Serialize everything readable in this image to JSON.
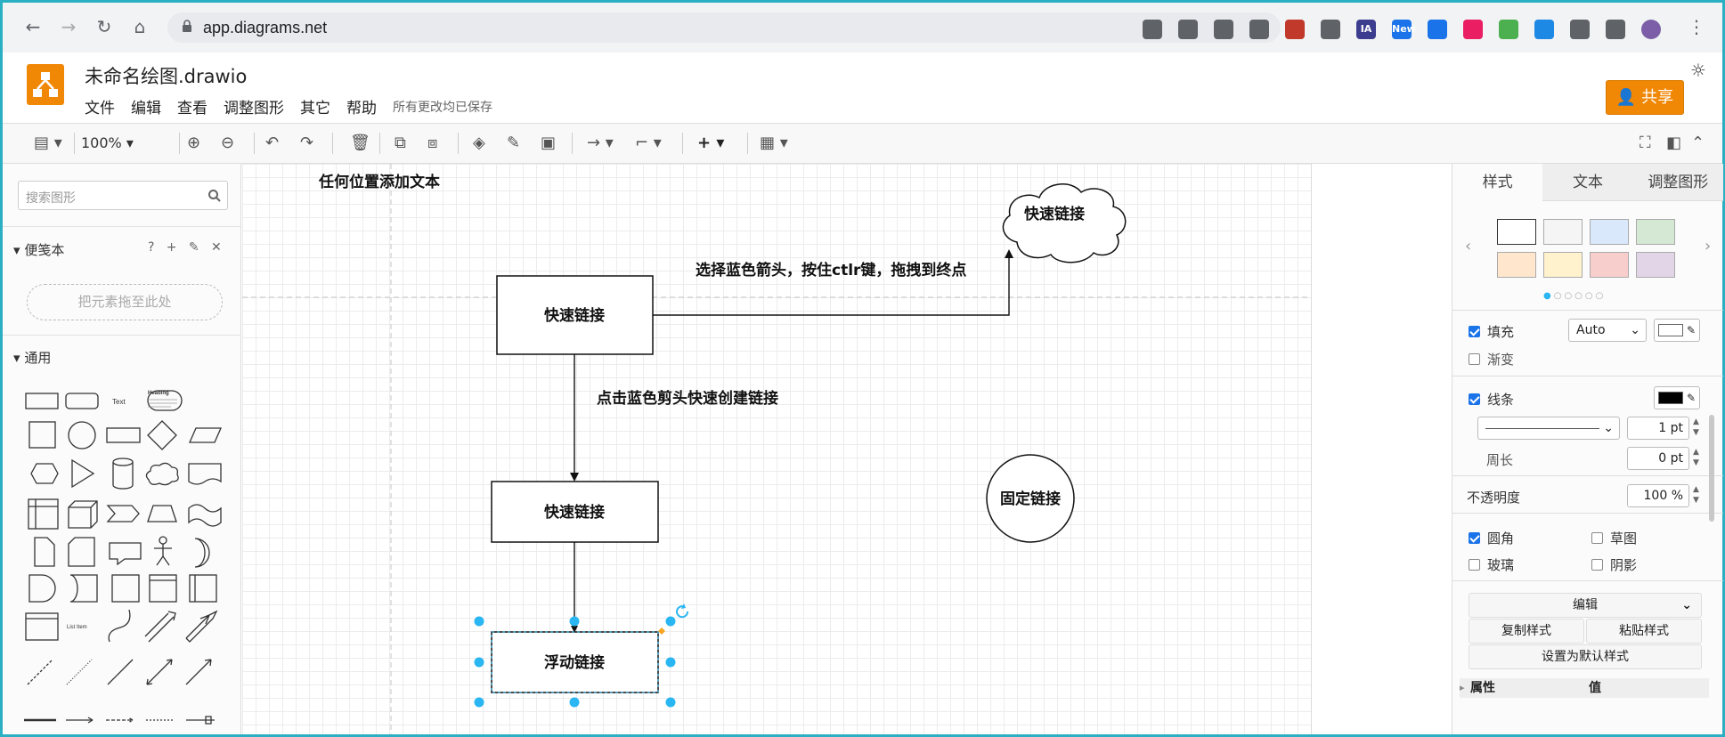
{
  "browser": {
    "url": "app.diagrams.net",
    "extensions": [
      {
        "name": "download-icon",
        "color": "#5f6368",
        "label": ""
      },
      {
        "name": "doc-icon",
        "color": "#5f6368",
        "label": ""
      },
      {
        "name": "share-page-icon",
        "color": "#5f6368",
        "label": ""
      },
      {
        "name": "star-icon",
        "color": "#5f6368",
        "label": ""
      },
      {
        "name": "html-ext-icon",
        "color": "#c0392b",
        "label": ""
      },
      {
        "name": "eyedropper-icon",
        "color": "#5f6368",
        "label": ""
      },
      {
        "name": "ia-ext-icon",
        "color": "#3d3d8f",
        "label": "IA"
      },
      {
        "name": "new-ext-icon",
        "color": "#1a73e8",
        "label": "New"
      },
      {
        "name": "circle-ext-icon",
        "color": "#1a73e8",
        "label": ""
      },
      {
        "name": "color-ext-icon",
        "color": "#e91e63",
        "label": ""
      },
      {
        "name": "grid-ext-icon",
        "color": "#4caf50",
        "label": ""
      },
      {
        "name": "drop-ext-icon",
        "color": "#1e88e5",
        "label": ""
      },
      {
        "name": "puzzle-icon",
        "color": "#5f6368",
        "label": ""
      },
      {
        "name": "sidebar-icon",
        "color": "#5f6368",
        "label": ""
      },
      {
        "name": "profile-icon",
        "color": "#7b5ea7",
        "label": ""
      }
    ]
  },
  "header": {
    "title": "未命名绘图.drawio",
    "menu": [
      "文件",
      "编辑",
      "查看",
      "调整图形",
      "其它",
      "帮助"
    ],
    "saved_status": "所有更改均已保存",
    "share_label": "共享",
    "brand_color": "#f08705"
  },
  "toolbar": {
    "zoom": "100%"
  },
  "left_panel": {
    "search_placeholder": "搜索图形",
    "scratchpad_title": "便笺本",
    "scratchpad_actions": [
      "?",
      "+"
    ],
    "drop_hint": "把元素拖至此处",
    "general_title": "通用",
    "shape_labels": {
      "text": "Text",
      "heading": "Heading",
      "list_item": "List Item"
    }
  },
  "diagram": {
    "top_text": "任何位置添加文本",
    "box1": "快速链接",
    "cloud": "快速链接",
    "arrow1_label": "选择蓝色箭头，按住ctlr键，拖拽到终点",
    "arrow2_label": "点击蓝色剪头快速创建链接",
    "box2": "快速链接",
    "circle": "固定链接",
    "box3": "浮动链接",
    "selection_color": "#29b6f2"
  },
  "right_panel": {
    "tabs": [
      "样式",
      "文本",
      "调整图形"
    ],
    "swatches": [
      "#ffffff",
      "#f5f5f5",
      "#dae8fc",
      "#d5e8d4",
      "#ffe6cc",
      "#fff2cc",
      "#f8cecc",
      "#e1d5e7"
    ],
    "fill_label": "填充",
    "fill_value": "Auto",
    "gradient_label": "渐变",
    "line_label": "线条",
    "line_width": "1 pt",
    "perimeter_label": "周长",
    "perimeter_value": "0 pt",
    "opacity_label": "不透明度",
    "opacity_value": "100 %",
    "rounded_label": "圆角",
    "sketch_label": "草图",
    "glass_label": "玻璃",
    "shadow_label": "阴影",
    "edit_label": "编辑",
    "copy_style": "复制样式",
    "paste_style": "粘贴样式",
    "set_default_style": "设置为默认样式",
    "prop_header": "属性",
    "value_header": "值"
  }
}
